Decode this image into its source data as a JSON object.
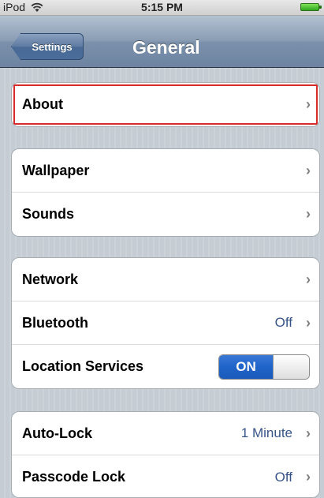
{
  "status_bar": {
    "carrier": "iPod",
    "time": "5:15 PM"
  },
  "nav": {
    "back_label": "Settings",
    "title": "General"
  },
  "groups": [
    {
      "rows": [
        {
          "label": "About",
          "value": "",
          "accessory": "chevron-right-icon"
        }
      ]
    },
    {
      "rows": [
        {
          "label": "Wallpaper",
          "value": "",
          "accessory": "chevron-right-icon"
        },
        {
          "label": "Sounds",
          "value": "",
          "accessory": "chevron-right-icon"
        }
      ]
    },
    {
      "rows": [
        {
          "label": "Network",
          "value": "",
          "accessory": "chevron-right-icon"
        },
        {
          "label": "Bluetooth",
          "value": "Off",
          "accessory": "chevron-right-icon"
        },
        {
          "label": "Location Services",
          "toggle": "ON",
          "accessory": "toggle"
        }
      ]
    },
    {
      "rows": [
        {
          "label": "Auto-Lock",
          "value": "1 Minute",
          "accessory": "chevron-right-icon"
        },
        {
          "label": "Passcode Lock",
          "value": "Off",
          "accessory": "chevron-right-icon"
        }
      ]
    }
  ],
  "colors": {
    "value_text": "#385487",
    "highlight": "#d62b2b",
    "toggle_on": "#1f64c9"
  }
}
